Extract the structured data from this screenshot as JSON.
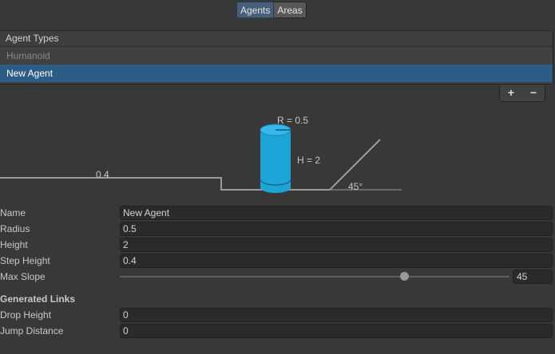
{
  "tabs": [
    {
      "label": "Agents",
      "active": true
    },
    {
      "label": "Areas",
      "active": false
    }
  ],
  "agent_list": {
    "header": "Agent Types",
    "items": [
      {
        "label": "Humanoid",
        "selected": false
      },
      {
        "label": "New Agent",
        "selected": true
      }
    ],
    "add_label": "+",
    "remove_label": "−"
  },
  "diagram": {
    "radius_label": "R = 0.5",
    "height_label": "H = 2",
    "step_label": "0.4",
    "slope_label": "45°",
    "cylinder_color": "#1ea5d8"
  },
  "fields": {
    "name": {
      "label": "Name",
      "value": "New Agent"
    },
    "radius": {
      "label": "Radius",
      "value": "0.5"
    },
    "height": {
      "label": "Height",
      "value": "2"
    },
    "step_height": {
      "label": "Step Height",
      "value": "0.4"
    },
    "max_slope": {
      "label": "Max Slope",
      "value": "45",
      "fraction": 0.73
    }
  },
  "generated_links": {
    "title": "Generated Links",
    "drop_height": {
      "label": "Drop Height",
      "value": "0"
    },
    "jump_distance": {
      "label": "Jump Distance",
      "value": "0"
    }
  }
}
